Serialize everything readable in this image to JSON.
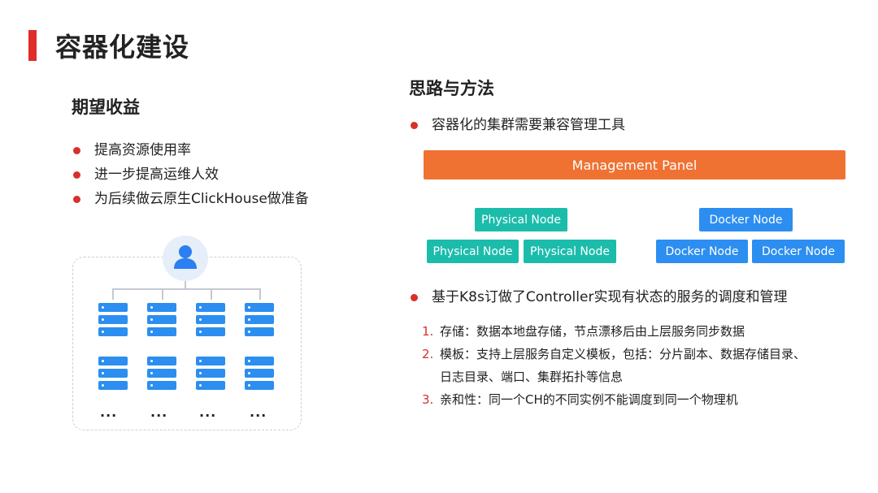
{
  "title": "容器化建设",
  "left": {
    "heading": "期望收益",
    "bullets": [
      "提高资源使用率",
      "进一步提高运维人效",
      "为后续做云原生ClickHouse做准备"
    ],
    "ellipsis": "..."
  },
  "right": {
    "heading": "思路与方法",
    "bullet1": "容器化的集群需要兼容管理工具",
    "management_panel": "Management Panel",
    "physical_node": "Physical Node",
    "docker_node": "Docker Node",
    "bullet2": "基于K8s订做了Controller实现有状态的服务的调度和管理",
    "items": [
      {
        "num": "1.",
        "text": "存储：数据本地盘存储，节点漂移后由上层服务同步数据"
      },
      {
        "num": "2.",
        "text": "模板：支持上层服务自定义模板，包括：分片副本、数据存储目录、",
        "cont": "日志目录、端口、集群拓扑等信息"
      },
      {
        "num": "3.",
        "text": "亲和性：同一个CH的不同实例不能调度到同一个物理机"
      }
    ]
  },
  "colors": {
    "accent_red": "#e02d2a",
    "management_orange": "#ef7233",
    "physical_teal": "#1cbcab",
    "docker_blue": "#2c8ef0",
    "server_blue": "#2b8ef0"
  },
  "icons": [
    "user-avatar-icon",
    "server-rack-icon"
  ]
}
